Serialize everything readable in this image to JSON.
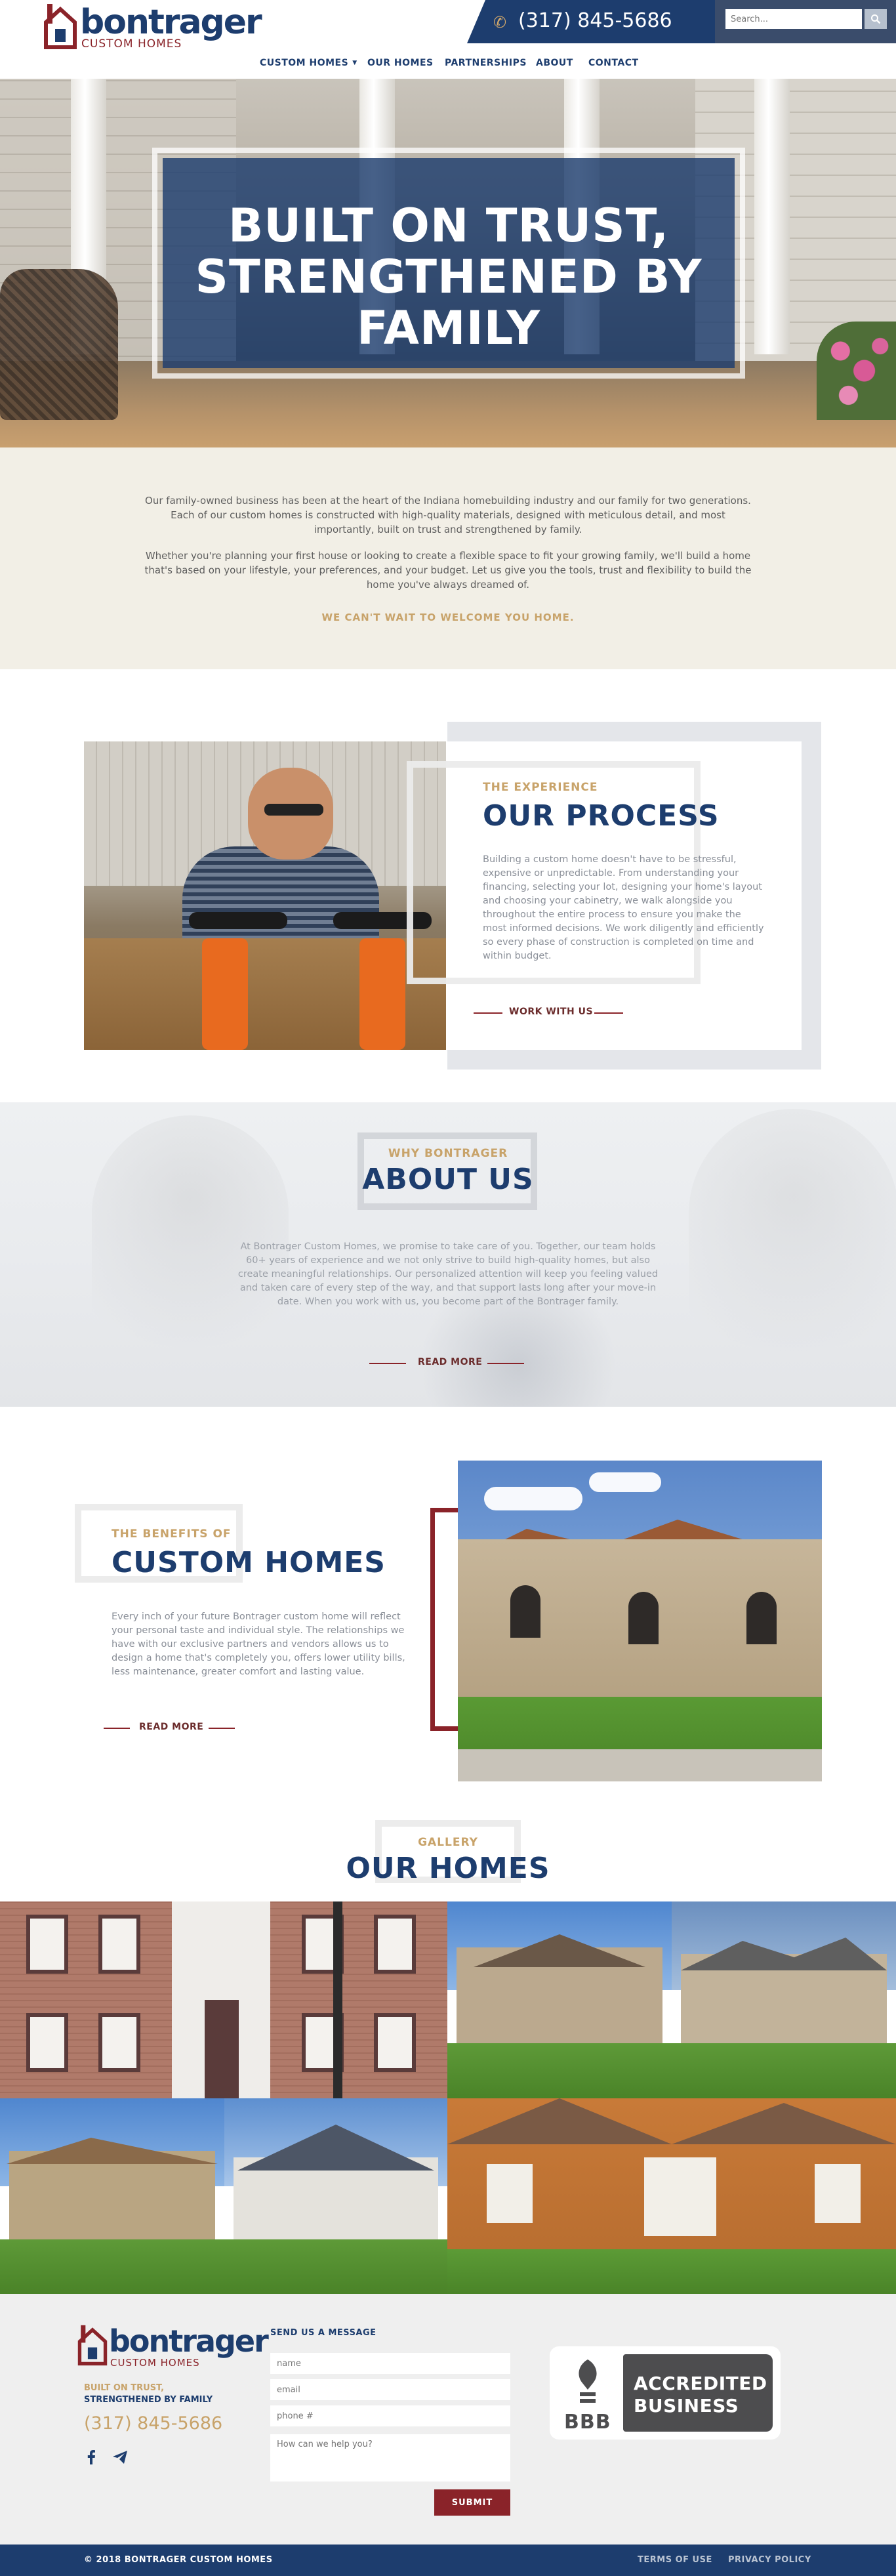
{
  "header": {
    "logo_name": "bontrager",
    "logo_sub": "CUSTOM HOMES",
    "phone": "(317) 845-5686",
    "search_placeholder": "Search...",
    "nav": [
      "CUSTOM HOMES",
      "OUR HOMES",
      "PARTNERSHIPS",
      "ABOUT",
      "CONTACT"
    ]
  },
  "hero": {
    "title_line1": "BUILT ON TRUST,",
    "title_line2": "STRENGTHENED BY",
    "title_line3": "FAMILY"
  },
  "intro": {
    "p1": "Our family-owned business has been at the heart of the Indiana homebuilding industry and our family for two generations. Each of our custom homes is constructed with high-quality materials, designed with meticulous detail, and most importantly, built on trust and strengthened by family.",
    "p2": "Whether you're planning your first house or looking to create a flexible space to fit your growing family, we'll build a home that's based on your lifestyle, your preferences, and your budget. Let us give you the tools, trust and flexibility to build the home you've always dreamed of.",
    "welcome": "WE CAN'T WAIT TO WELCOME YOU HOME."
  },
  "process": {
    "kicker": "THE EXPERIENCE",
    "title": "OUR PROCESS",
    "body": "Building a custom home doesn't have to be stressful, expensive or unpredictable. From understanding your financing, selecting your lot, designing your home's layout and choosing your cabinetry, we walk alongside you throughout the entire process to ensure you make the most informed decisions. We work diligently and efficiently so every phase of construction is completed on time and within budget.",
    "link": "WORK WITH US"
  },
  "about": {
    "kicker": "WHY BONTRAGER",
    "title": "ABOUT US",
    "body": "At Bontrager Custom Homes, we promise to take care of you. Together, our team holds 60+ years of experience and we not only strive to build high-quality homes, but also create meaningful relationships. Our personalized attention will keep you feeling valued and taken care of every step of the way, and that support lasts long after your move-in date. When you work with us, you become part of the Bontrager family.",
    "link": "READ MORE"
  },
  "benefits": {
    "kicker": "THE BENEFITS OF",
    "title": "CUSTOM HOMES",
    "body": "Every inch of your future Bontrager custom home will reflect your personal taste and individual style. The relationships we have with our exclusive partners and vendors allows us to design a home that's completely you, offers lower utility bills, less maintenance, greater comfort and lasting value.",
    "link": "READ MORE"
  },
  "gallery": {
    "kicker": "GALLERY",
    "title": "OUR HOMES"
  },
  "footer": {
    "logo_name": "bontrager",
    "logo_sub": "CUSTOM HOMES",
    "tag1": "BUILT ON TRUST,",
    "tag2": "STRENGTHENED BY FAMILY",
    "phone": "(317) 845-5686",
    "form_title": "SEND US A MESSAGE",
    "name_placeholder": "name",
    "email_placeholder": "email",
    "phone_placeholder": "phone #",
    "message_placeholder": "How can we help you?",
    "submit": "SUBMIT",
    "bbb_line1": "ACCREDITED",
    "bbb_line2": "BUSINESS",
    "bbb_logo": "BBB",
    "copyright": "© 2018 BONTRAGER CUSTOM HOMES",
    "terms": "TERMS OF USE",
    "privacy": "PRIVACY POLICY"
  },
  "colors": {
    "navy": "#1d3d6e",
    "maroon": "#8a2329",
    "gold": "#c8a36a",
    "cream": "#f2efe6"
  }
}
